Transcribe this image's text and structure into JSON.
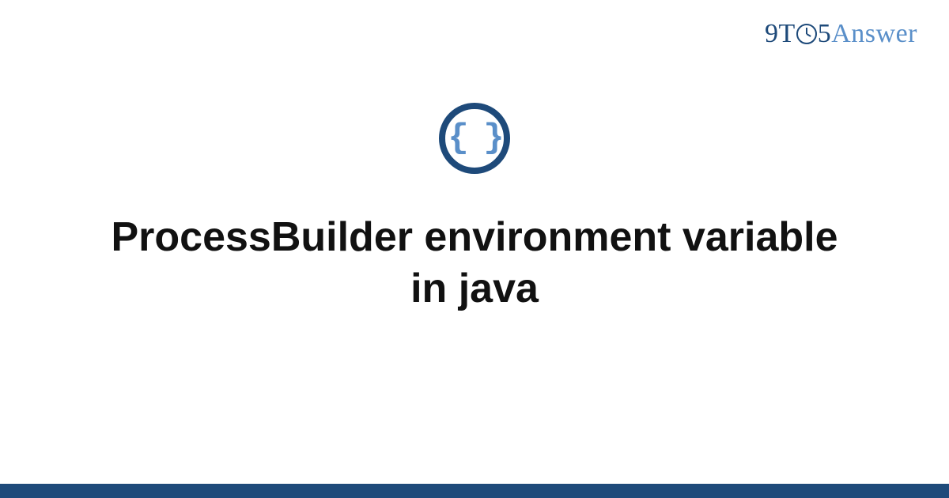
{
  "logo": {
    "part1": "9T",
    "part2": "5",
    "part3": "Answer"
  },
  "icon": {
    "name": "braces-icon",
    "glyph": "{ }"
  },
  "title": "ProcessBuilder environment variable in java",
  "colors": {
    "primary": "#1e4a7a",
    "accent": "#5a8fc9"
  }
}
